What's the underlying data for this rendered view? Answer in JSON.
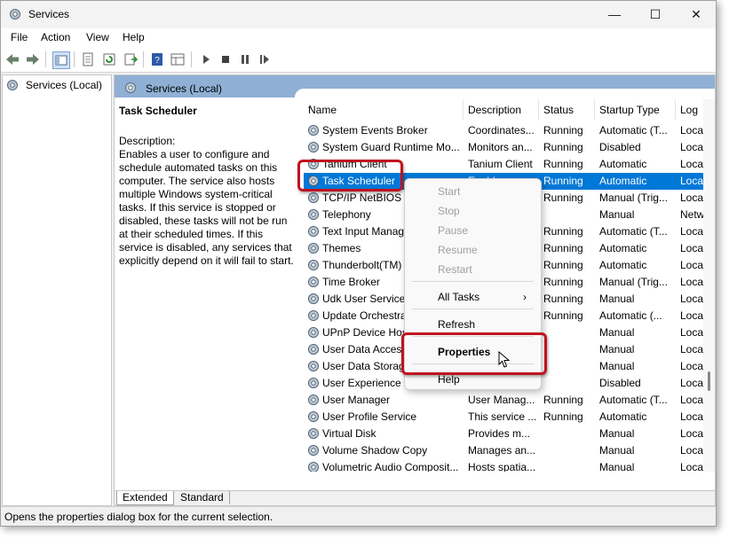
{
  "window": {
    "title": "Services",
    "minimize_glyph": "—",
    "maximize_glyph": "☐",
    "close_glyph": "✕"
  },
  "menu": [
    "File",
    "Action",
    "View",
    "Help"
  ],
  "tree": {
    "label": "Services (Local)"
  },
  "header": {
    "title": "Services (Local)"
  },
  "description": {
    "title": "Task Scheduler",
    "label": "Description:",
    "text": "Enables a user to configure and schedule automated tasks on this computer. The service also hosts multiple Windows system-critical tasks. If this service is stopped or disabled, these tasks will not be run at their scheduled times. If this service is disabled, any services that explicitly depend on it will fail to start."
  },
  "columns": [
    "Name",
    "Description",
    "Status",
    "Startup Type",
    "Log"
  ],
  "rows": [
    {
      "name": "System Events Broker",
      "desc": "Coordinates...",
      "status": "Running",
      "startup": "Automatic (T...",
      "log": "Loca"
    },
    {
      "name": "System Guard Runtime Mo...",
      "desc": "Monitors an...",
      "status": "Running",
      "startup": "Disabled",
      "log": "Loca"
    },
    {
      "name": "Tanium Client",
      "desc": "Tanium Client",
      "status": "Running",
      "startup": "Automatic",
      "log": "Loca"
    },
    {
      "name": "Task Scheduler",
      "desc": "Enables a us...",
      "status": "Running",
      "startup": "Automatic",
      "log": "Loca"
    },
    {
      "name": "TCP/IP NetBIOS Helper",
      "desc": "",
      "status": "Running",
      "startup": "Manual (Trig...",
      "log": "Loca"
    },
    {
      "name": "Telephony",
      "desc": "",
      "status": "",
      "startup": "Manual",
      "log": "Netw"
    },
    {
      "name": "Text Input Management",
      "desc": "",
      "status": "Running",
      "startup": "Automatic (T...",
      "log": "Loca"
    },
    {
      "name": "Themes",
      "desc": "",
      "status": "Running",
      "startup": "Automatic",
      "log": "Loca"
    },
    {
      "name": "Thunderbolt(TM)",
      "desc": "",
      "status": "Running",
      "startup": "Automatic",
      "log": "Loca"
    },
    {
      "name": "Time Broker",
      "desc": "",
      "status": "Running",
      "startup": "Manual (Trig...",
      "log": "Loca"
    },
    {
      "name": "Udk User Service_",
      "desc": "",
      "status": "Running",
      "startup": "Manual",
      "log": "Loca"
    },
    {
      "name": "Update Orchestrator",
      "desc": "",
      "status": "Running",
      "startup": "Automatic (...",
      "log": "Loca"
    },
    {
      "name": "UPnP Device Host",
      "desc": "",
      "status": "",
      "startup": "Manual",
      "log": "Loca"
    },
    {
      "name": "User Data Access_",
      "desc": "",
      "status": "",
      "startup": "Manual",
      "log": "Loca"
    },
    {
      "name": "User Data Storage_",
      "desc": "",
      "status": "",
      "startup": "Manual",
      "log": "Loca"
    },
    {
      "name": "User Experience Virt",
      "desc": "",
      "status": "",
      "startup": "Disabled",
      "log": "Loca"
    },
    {
      "name": "User Manager",
      "desc": "User Manag...",
      "status": "Running",
      "startup": "Automatic (T...",
      "log": "Loca"
    },
    {
      "name": "User Profile Service",
      "desc": "This service ...",
      "status": "Running",
      "startup": "Automatic",
      "log": "Loca"
    },
    {
      "name": "Virtual Disk",
      "desc": "Provides m...",
      "status": "",
      "startup": "Manual",
      "log": "Loca"
    },
    {
      "name": "Volume Shadow Copy",
      "desc": "Manages an...",
      "status": "",
      "startup": "Manual",
      "log": "Loca"
    },
    {
      "name": "Volumetric Audio Composit...",
      "desc": "Hosts spatia...",
      "status": "",
      "startup": "Manual",
      "log": "Loca"
    }
  ],
  "context_menu": {
    "start": "Start",
    "stop": "Stop",
    "pause": "Pause",
    "resume": "Resume",
    "restart": "Restart",
    "all_tasks": "All Tasks",
    "all_tasks_arrow": "›",
    "refresh": "Refresh",
    "properties": "Properties",
    "help": "Help"
  },
  "tabs": [
    "Extended",
    "Standard"
  ],
  "status_bar": "Opens the properties dialog box for the current selection.",
  "colors": {
    "selection": "#0078d7",
    "header_band": "#8fb0d4",
    "highlight": "#c1121f"
  }
}
